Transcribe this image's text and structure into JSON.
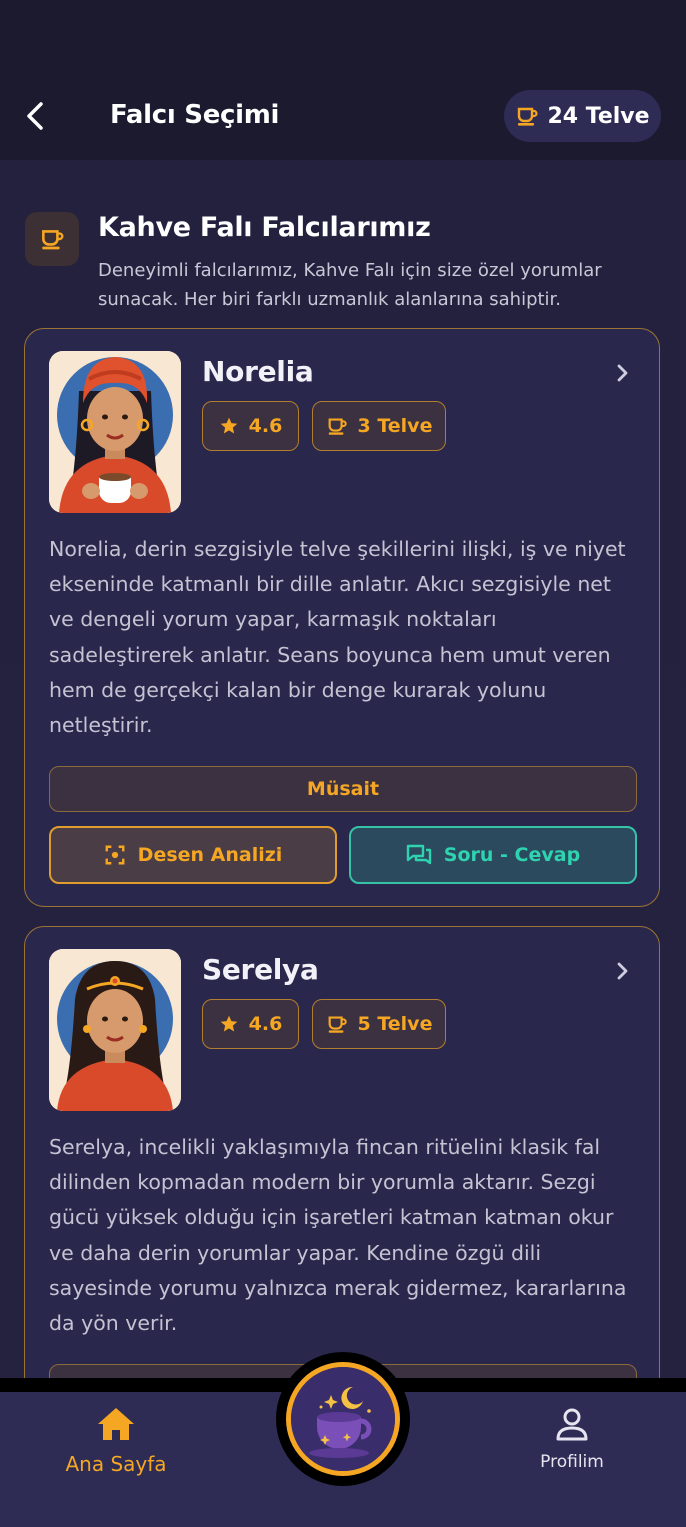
{
  "header": {
    "title": "Falcı Seçimi",
    "credits": "24 Telve"
  },
  "section": {
    "title": "Kahve Falı Falcılarımız",
    "description": "Deneyimli falcılarımız, Kahve Falı için size özel yorumlar sunacak. Her biri farklı uzmanlık alanlarına sahiptir."
  },
  "fortune_tellers": [
    {
      "name": "Norelia",
      "rating": "4.6",
      "cost": "3 Telve",
      "description": "Norelia, derin sezgisiyle telve şekillerini ilişki, iş ve niyet ekseninde katmanlı bir dille anlatır. Akıcı sezgisiyle net ve dengeli yorum yapar, karmaşık noktaları sadeleştirerek anlatır. Seans boyunca hem umut veren hem de gerçekçi kalan bir denge kurarak yolunu netleştirir.",
      "status": "Müsait",
      "action_pattern": "Desen Analizi",
      "action_qa": "Soru - Cevap"
    },
    {
      "name": "Serelya",
      "rating": "4.6",
      "cost": "5 Telve",
      "description": "Serelya, incelikli yaklaşımıyla fincan ritüelini klasik fal dilinden kopmadan modern bir yorumla aktarır. Sezgi gücü yüksek olduğu için işaretleri katman katman okur ve daha derin yorumlar yapar. Kendine özgü dili sayesinde yorumu yalnızca merak gidermez, kararlarına da yön verir."
    }
  ],
  "bottom_nav": {
    "home": "Ana Sayfa",
    "profile": "Profilim"
  },
  "colors": {
    "accent": "#f5a623",
    "teal": "#2ed3b0",
    "background": "#24213f",
    "card": "#29274c"
  }
}
